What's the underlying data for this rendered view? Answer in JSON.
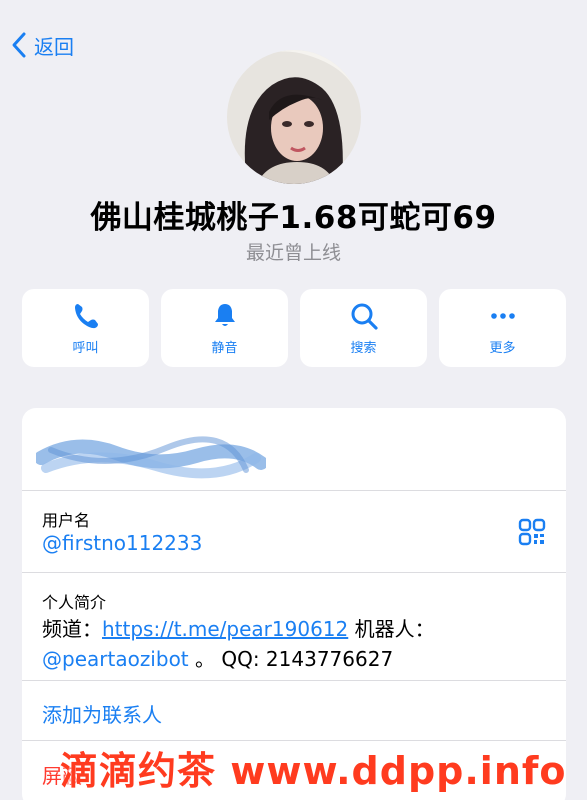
{
  "nav": {
    "back_label": "返回"
  },
  "profile": {
    "name": "佛山桂城桃子1.68可蛇可69",
    "status": "最近曾上线"
  },
  "actions": [
    {
      "label": "呼叫",
      "icon": "phone-icon"
    },
    {
      "label": "静音",
      "icon": "bell-icon"
    },
    {
      "label": "搜索",
      "icon": "search-icon"
    },
    {
      "label": "更多",
      "icon": "more-icon"
    }
  ],
  "info": {
    "username_label": "用户名",
    "username_value": "@firstno112233",
    "bio_label": "个人简介",
    "bio": {
      "channel_prefix": "频道：",
      "channel_link": "https://t.me/pear190612",
      "bot_prefix": " 机器人：",
      "bot_mention": "@peartaozibot",
      "qq_text": "。 QQ: 2143776627"
    },
    "add_contact": "添加为联系人",
    "block_label": "屏蔽"
  },
  "watermark": "滴滴约茶 www.ddpp.info",
  "colors": {
    "accent": "#1a7ff2",
    "background": "#efeff4",
    "watermark": "#ff3b1f"
  }
}
